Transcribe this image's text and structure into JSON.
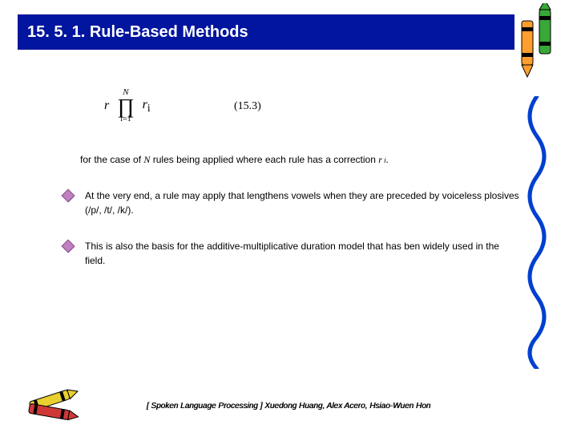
{
  "title": "15. 5. 1. Rule-Based Methods",
  "formula": {
    "lhs": "r",
    "prod_upper": "N",
    "prod_lower": "i=1",
    "term": "r",
    "term_sub": "i"
  },
  "equation_number": "(15.3)",
  "intro_text_before_N": "for the case of ",
  "intro_N": "N",
  "intro_text_mid": " rules being applied where each rule has a correction ",
  "intro_r": "r",
  "intro_sub": " i",
  "intro_end": ".",
  "bullets": [
    "At the very end, a rule may apply that lengthens vowels when they are preceded by voiceless plosives (/p/, /t/, /k/).",
    "This is also the basis for the additive-multiplicative duration model that has ben widely used in the field."
  ],
  "footer": "[ Spoken Language Processing ]  Xuedong Huang, Alex Acero, Hsiao-Wuen Hon"
}
